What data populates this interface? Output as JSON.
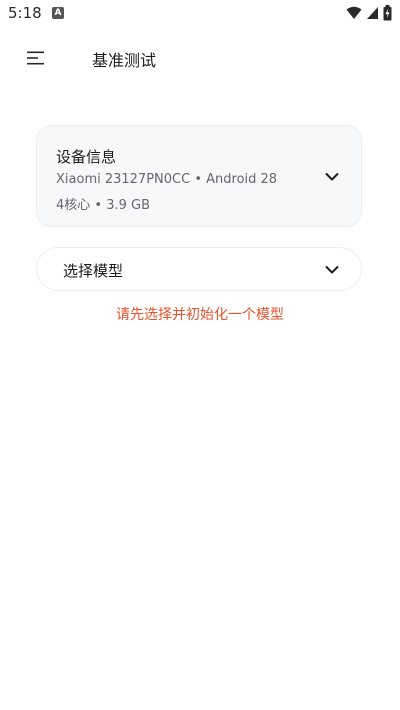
{
  "status_bar": {
    "time": "5:18",
    "notification_icon": "a-icon",
    "icons": [
      "wifi-icon",
      "cellular-icon",
      "battery-charging-icon"
    ]
  },
  "app_bar": {
    "menu_icon": "hamburger-menu-icon",
    "title": "基准测试"
  },
  "device_info": {
    "title": "设备信息",
    "line1": "Xiaomi 23127PN0CC • Android 28",
    "line2": "4核心 • 3.9 GB",
    "expand_icon": "chevron-down-icon"
  },
  "model_select": {
    "label": "选择模型",
    "expand_icon": "chevron-down-icon"
  },
  "warning": {
    "text": "请先选择并初始化一个模型",
    "color": "#e5532d"
  }
}
